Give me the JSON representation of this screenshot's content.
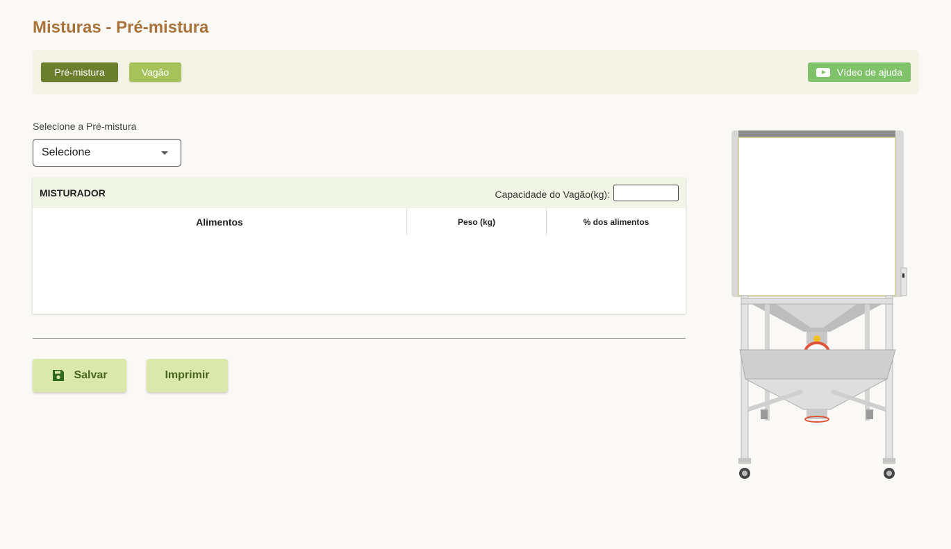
{
  "page": {
    "title": "Misturas - Pré-mistura"
  },
  "tabs": [
    {
      "label": "Pré-mistura",
      "active": true
    },
    {
      "label": "Vagão",
      "active": false
    }
  ],
  "help_button": {
    "label": "Vídeo de ajuda",
    "icon": "video-play-icon"
  },
  "premix_select": {
    "label": "Selecione a Pré-mistura",
    "value": "Selecione"
  },
  "mixer": {
    "title": "MISTURADOR",
    "capacity_label": "Capacidade do Vagão(kg):",
    "capacity_value": "",
    "columns": [
      "Alimentos",
      "Peso (kg)",
      "% dos alimentos"
    ],
    "rows": []
  },
  "actions": {
    "save_label": "Salvar",
    "save_icon": "floppy-disk-icon",
    "print_label": "Imprimir"
  },
  "colors": {
    "title": "#a8733a",
    "tab_active": "#6b7f2c",
    "tab_inactive": "#a6c25a",
    "help": "#7fc26a",
    "action_bg": "#dbe8ac",
    "action_text": "#47651e"
  }
}
